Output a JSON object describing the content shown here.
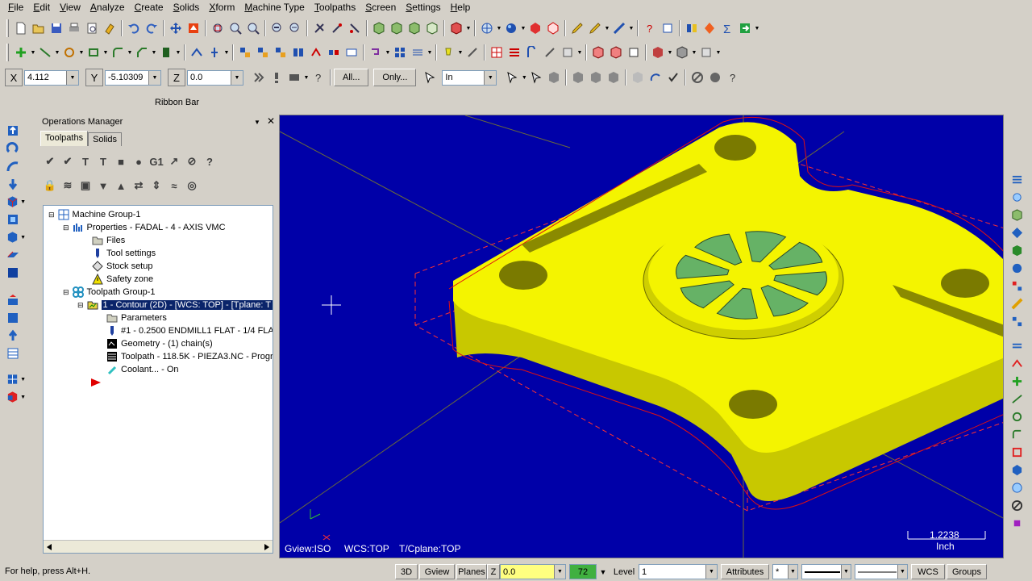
{
  "menu": [
    "File",
    "Edit",
    "View",
    "Analyze",
    "Create",
    "Solids",
    "Xform",
    "Machine Type",
    "Toolpaths",
    "Screen",
    "Settings",
    "Help"
  ],
  "autocursor": {
    "x_label": "X",
    "x_value": "4.112",
    "y_label": "Y",
    "y_value": "-5.10309",
    "z_label": "Z",
    "z_value": "0.0",
    "all_button": "All...",
    "only_button": "Only...",
    "units_value": "In"
  },
  "ribbon_label": "Ribbon Bar",
  "ops": {
    "title": "Operations Manager",
    "tabs": [
      "Toolpaths",
      "Solids"
    ],
    "tree": [
      {
        "label": "Machine Group-1",
        "icon": "machine-group-icon"
      },
      {
        "label": "Properties - FADAL - 4 - AXIS VMC",
        "icon": "properties-icon"
      },
      {
        "label": "Files",
        "icon": "folder-icon"
      },
      {
        "label": "Tool settings",
        "icon": "tool-icon"
      },
      {
        "label": "Stock setup",
        "icon": "stock-icon"
      },
      {
        "label": "Safety zone",
        "icon": "warning-icon"
      },
      {
        "label": "Toolpath Group-1",
        "icon": "toolpath-group-icon"
      },
      {
        "label": "1 - Contour (2D) - [WCS: TOP] - [Tplane: T",
        "icon": "operation-folder-icon"
      },
      {
        "label": "Parameters",
        "icon": "folder-icon"
      },
      {
        "label": "#1 - 0.2500 ENDMILL1 FLAT -  1/4 FLA",
        "icon": "tool-icon"
      },
      {
        "label": "Geometry - (1) chain(s)",
        "icon": "geometry-icon"
      },
      {
        "label": "Toolpath - 118.5K - PIEZA3.NC - Progr",
        "icon": "toolpath-icon"
      },
      {
        "label": "Coolant... - On",
        "icon": "coolant-icon"
      }
    ]
  },
  "viewport": {
    "gview": "Gview:ISO",
    "wcs": "WCS:TOP",
    "tcplane": "T/Cplane:TOP",
    "scale_value": "1.2238",
    "scale_unit": "Inch",
    "bg_color": "#0000a8",
    "part_color": "#f4f400",
    "pocket_color": "#66b266"
  },
  "status": {
    "help": "For help, press Alt+H.",
    "view3d": "3D",
    "gview": "Gview",
    "planes": "Planes",
    "z_label": "Z",
    "z_value": "0.0",
    "color_value": "72",
    "level_label": "Level",
    "level_value": "1",
    "attributes": "Attributes",
    "point_style": "*",
    "wcs": "WCS",
    "groups": "Groups"
  }
}
